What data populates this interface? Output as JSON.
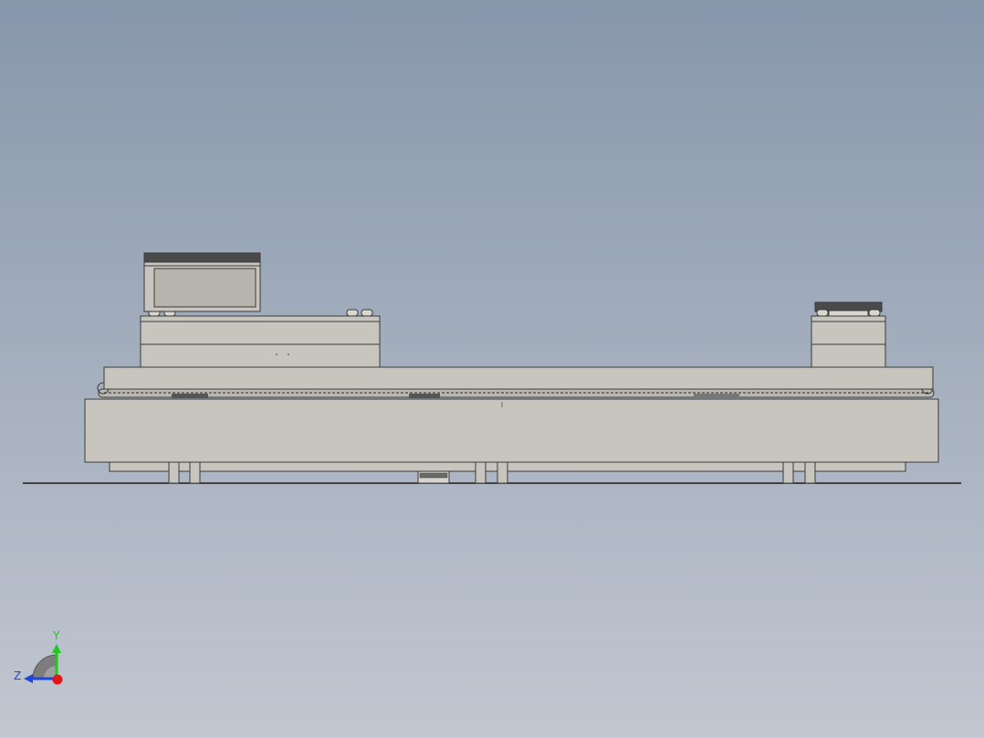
{
  "viewport": {
    "background_top": "#8797ab",
    "background_bottom": "#c2c7d1"
  },
  "model": {
    "part_fill": "#c7c5bd",
    "part_edge": "#3a3a3a",
    "dark_part": "#4a4a4a"
  },
  "triad": {
    "y_label": "Y",
    "z_label": "Z",
    "y_color": "#1ec81e",
    "z_color": "#1e46dc",
    "x_color": "#e01818"
  }
}
